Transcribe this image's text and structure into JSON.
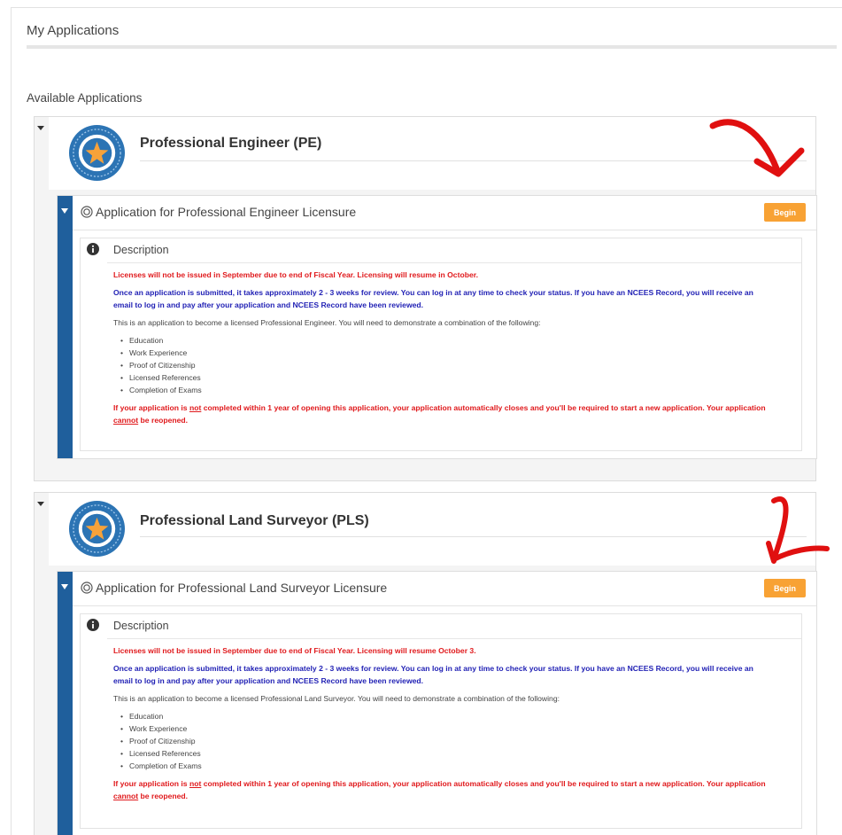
{
  "page": {
    "title": "My Applications",
    "section_label": "Available Applications"
  },
  "applications": [
    {
      "title": "Professional Engineer (PE)",
      "card_title": "Application for Professional Engineer Licensure",
      "begin_label": "Begin",
      "description_header": "Description",
      "notice": "Licenses will not be issued in September due to end of Fiscal Year.  Licensing will resume in October.",
      "review_line1": "Once an application is submitted, it takes approximately 2 - 3 weeks for review.  You can log in at any time to check your status.  If you have an NCEES Record, you will receive an",
      "review_line2": "email to log in and pay after your application and NCEES Record have been reviewed.",
      "intro": "This is an application to become a licensed Professional Engineer. You will need to demonstrate a combination of the following:",
      "requirements": [
        "Education",
        "Work Experience",
        "Proof of Citizenship",
        "Licensed References",
        "Completion of Exams"
      ],
      "warning_pre": "If your application is ",
      "warning_not": "not",
      "warning_mid": " completed within 1 year of opening this application, your application automatically closes and you'll be required to start a new application. Your application",
      "warning_cannot": "cannot",
      "warning_post": " be reopened."
    },
    {
      "title": "Professional Land Surveyor (PLS)",
      "card_title": "Application for Professional Land Surveyor Licensure",
      "begin_label": "Begin",
      "description_header": "Description",
      "notice": "Licenses will not be issued in September due to end of Fiscal Year.  Licensing will resume October 3.",
      "review_line1": "Once an application is submitted, it takes approximately 2 - 3 weeks for review.  You can log in at any time to check your status.  If you have an NCEES Record, you will receive an",
      "review_line2": "email to log in and pay after your application and NCEES Record have been reviewed.",
      "intro": "This is an application to become a licensed Professional Land Surveyor. You will need to demonstrate a combination of the following:",
      "requirements": [
        "Education",
        "Work Experience",
        "Proof of Citizenship",
        "Licensed References",
        "Completion of Exams"
      ],
      "warning_pre": "If your application is ",
      "warning_not": "not",
      "warning_mid": " completed within 1 year of opening this application, your application automatically closes and you'll be required to start a new application. Your application",
      "warning_cannot": "cannot",
      "warning_post": " be reopened."
    }
  ],
  "colors": {
    "accent_blue": "#1f5f9c",
    "begin_orange": "#f8a234",
    "notice_red": "#e0191c",
    "info_blue": "#2222b5",
    "annotation_red": "#e01010"
  },
  "icons": {
    "logo": "star-badge-icon",
    "card": "target-icon",
    "description": "info-circle-icon",
    "collapse": "caret-down-icon"
  }
}
